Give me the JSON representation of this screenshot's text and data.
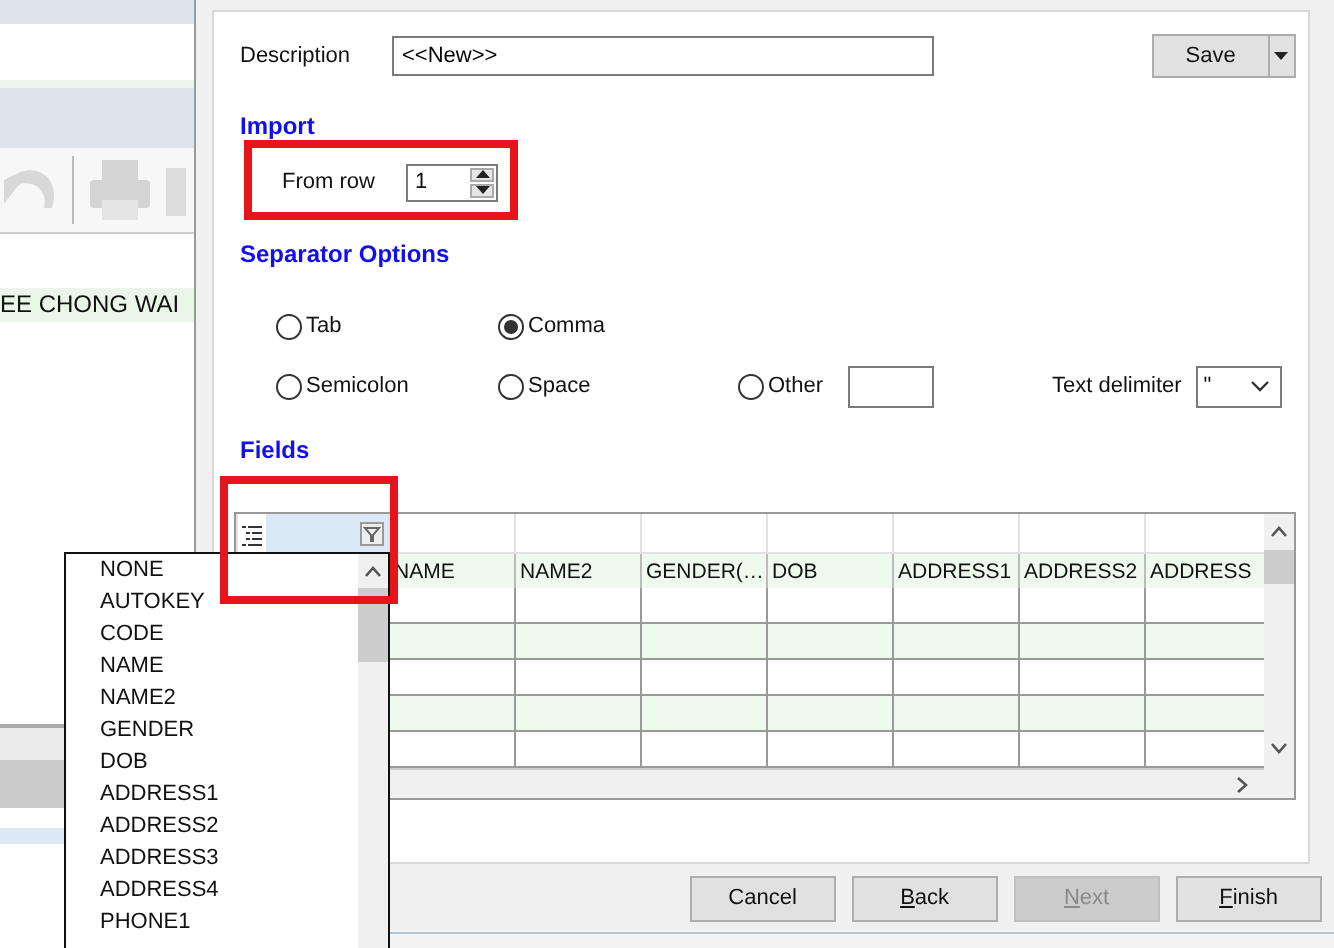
{
  "background_app": {
    "selected_row": {
      "text": "EE CHONG WAI"
    }
  },
  "description": {
    "label": "Description",
    "value": "<<New>>"
  },
  "save_button": {
    "label": "Save"
  },
  "import": {
    "title": "Import",
    "from_row": {
      "label": "From row",
      "value": "1"
    }
  },
  "separator_options": {
    "title": "Separator Options",
    "options": [
      {
        "label": "Tab",
        "selected": false,
        "kind": "radio"
      },
      {
        "label": "Comma",
        "selected": true,
        "kind": "radio"
      },
      {
        "label": "Semicolon",
        "selected": false,
        "kind": "radio"
      },
      {
        "label": "Space",
        "selected": false,
        "kind": "radio"
      },
      {
        "label": "Other",
        "selected": false,
        "kind": "radio_field"
      }
    ],
    "text_delimiter": {
      "label": "Text delimiter",
      "value": "\""
    }
  },
  "fields": {
    "title": "Fields",
    "columns": [
      "NAME",
      "NAME2",
      "GENDER(…",
      "DOB",
      "ADDRESS1",
      "ADDRESS2",
      "ADDRESS"
    ]
  },
  "buttons": [
    {
      "label": "Cancel",
      "disabled": false,
      "underline_first": false
    },
    {
      "label": "Back",
      "disabled": false,
      "underline_first": true
    },
    {
      "label": "Next",
      "disabled": true,
      "underline_first": true
    },
    {
      "label": "Finish",
      "disabled": false,
      "underline_first": true
    }
  ],
  "field_dropdown": {
    "items": [
      "NONE",
      "AUTOKEY",
      "CODE",
      "NAME",
      "NAME2",
      "GENDER",
      "DOB",
      "ADDRESS1",
      "ADDRESS2",
      "ADDRESS3",
      "ADDRESS4",
      "PHONE1"
    ]
  }
}
